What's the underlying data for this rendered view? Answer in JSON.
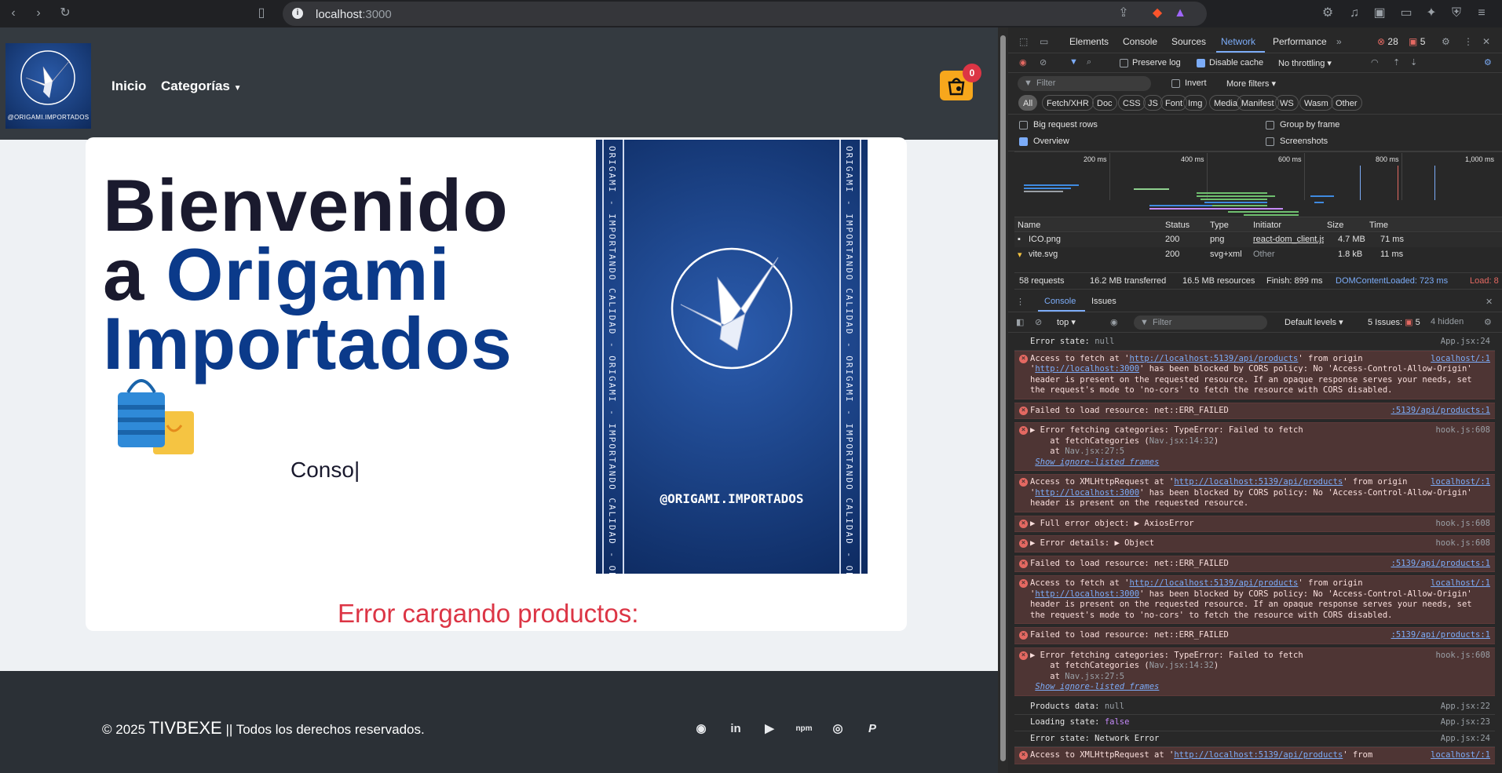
{
  "browser": {
    "url_host": "localhost",
    "url_port": ":3000"
  },
  "nav": {
    "logo_handle": "@ORIGAMI.IMPORTADOS",
    "link_home": "Inicio",
    "link_categories": "Categorías",
    "cart_count": "0"
  },
  "hero": {
    "line1": "Bienvenido",
    "line2_a": "a ",
    "line2_b": "Origami",
    "line3": "Importados",
    "typing_text": "Conso|"
  },
  "poster": {
    "strip_text": "ORIGAMI - IMPORTANDO CALIDAD - ORIGAMI - IMPORTANDO CALIDAD - ORIGAMI - IMPORTANDO CALIDAD",
    "handle": "@ORIGAMI.IMPORTADOS"
  },
  "error_text": "Error cargando productos:",
  "footer": {
    "copy_prefix": "© 2025 ",
    "brand": "TIVBEXE",
    "copy_suffix": " || Todos los derechos reservados.",
    "icons": [
      "github-icon",
      "linkedin-icon",
      "youtube-icon",
      "npm-icon",
      "chrome-icon",
      "paypal-icon"
    ]
  },
  "devtools": {
    "tabs": [
      "Elements",
      "Console",
      "Sources",
      "Network",
      "Performance"
    ],
    "active_tab": "Network",
    "error_count": "28",
    "issue_count": "5",
    "preserve_log": "Preserve log",
    "disable_cache": "Disable cache",
    "throttling": "No throttling",
    "filter_placeholder": "Filter",
    "invert": "Invert",
    "more_filters": "More filters",
    "chips": [
      "All",
      "Fetch/XHR",
      "Doc",
      "CSS",
      "JS",
      "Font",
      "Img",
      "Media",
      "Manifest",
      "WS",
      "Wasm",
      "Other"
    ],
    "big_request_rows": "Big request rows",
    "group_by_frame": "Group by frame",
    "overview": "Overview",
    "screenshots": "Screenshots",
    "timeline_ticks": [
      "200 ms",
      "400 ms",
      "600 ms",
      "800 ms",
      "1,000 ms"
    ],
    "table_headers": [
      "Name",
      "Status",
      "Type",
      "Initiator",
      "Size",
      "Time"
    ],
    "rows": [
      {
        "name": "ICO.png",
        "status": "200",
        "type": "png",
        "initiator": "react-dom_client.js?v",
        "size": "4.7 MB",
        "time": "71 ms"
      },
      {
        "name": "vite.svg",
        "status": "200",
        "type": "svg+xml",
        "initiator": "Other",
        "size": "1.8 kB",
        "time": "11 ms"
      }
    ],
    "summary": {
      "requests": "58 requests",
      "transferred": "16.2 MB transferred",
      "resources": "16.5 MB resources",
      "finish": "Finish: 899 ms",
      "dcl": "DOMContentLoaded: 723 ms",
      "load": "Load: 8"
    },
    "drawer_tabs": [
      "Console",
      "Issues"
    ],
    "context": "top",
    "levels": "Default levels",
    "issues_label": "5 Issues:",
    "issues_num": "5",
    "hidden": "4 hidden"
  },
  "console": {
    "m1_text": "Error state: ",
    "m1_val": "null",
    "m1_src": "App.jsx:24",
    "cors1_a": "Access to fetch at '",
    "cors1_url": "http://localhost:5139/api/products",
    "cors1_b": "' from origin '",
    "cors1_origin": "http://localhost:3000",
    "cors1_c": "' has been blocked by CORS policy: No 'Access-Control-Allow-Origin' header is present on the requested resource. If an opaque response serves your needs, set the request's mode to 'no-cors' to fetch the resource with CORS disabled.",
    "cors_src": "localhost/:1",
    "failed": "Failed to load resource: net::ERR_FAILED",
    "failed_src": ":5139/api/products:1",
    "fetchcat_a": "▶ Error fetching categories: TypeError: Failed to fetch",
    "fetchcat_b": "at fetchCategories (",
    "fetchcat_b2": "Nav.jsx:14:32",
    "fetchcat_c": "at ",
    "fetchcat_c2": "Nav.jsx:27:5",
    "fetchcat_src": "hook.js:608",
    "show_ignore": "Show ignore-listed frames",
    "xhr_a": "Access to XMLHttpRequest at '",
    "xhr_url": "http://localhost:5139/api/products",
    "xhr_b": "' from origin '",
    "xhr_origin": "http://localhost:3000",
    "xhr_c": "' has been blocked by CORS policy: No 'Access-Control-Allow-Origin' header is present on the requested resource.",
    "full_err": "▶ Full error object:  ▶ AxiosError",
    "full_src": "hook.js:608",
    "details": "▶ Error details:  ▶ Object",
    "details_src": "hook.js:608",
    "pd_text": "Products data: ",
    "pd_val": "null",
    "pd_src": "App.jsx:22",
    "ls_text": "Loading state: ",
    "ls_val": "false",
    "ls_src": "App.jsx:23",
    "es_text": "Error state: Network Error",
    "es_src": "App.jsx:24",
    "last_a": "Access to XMLHttpRequest at '",
    "last_url": "http://localhost:5139/api/products",
    "last_b": "' from"
  }
}
